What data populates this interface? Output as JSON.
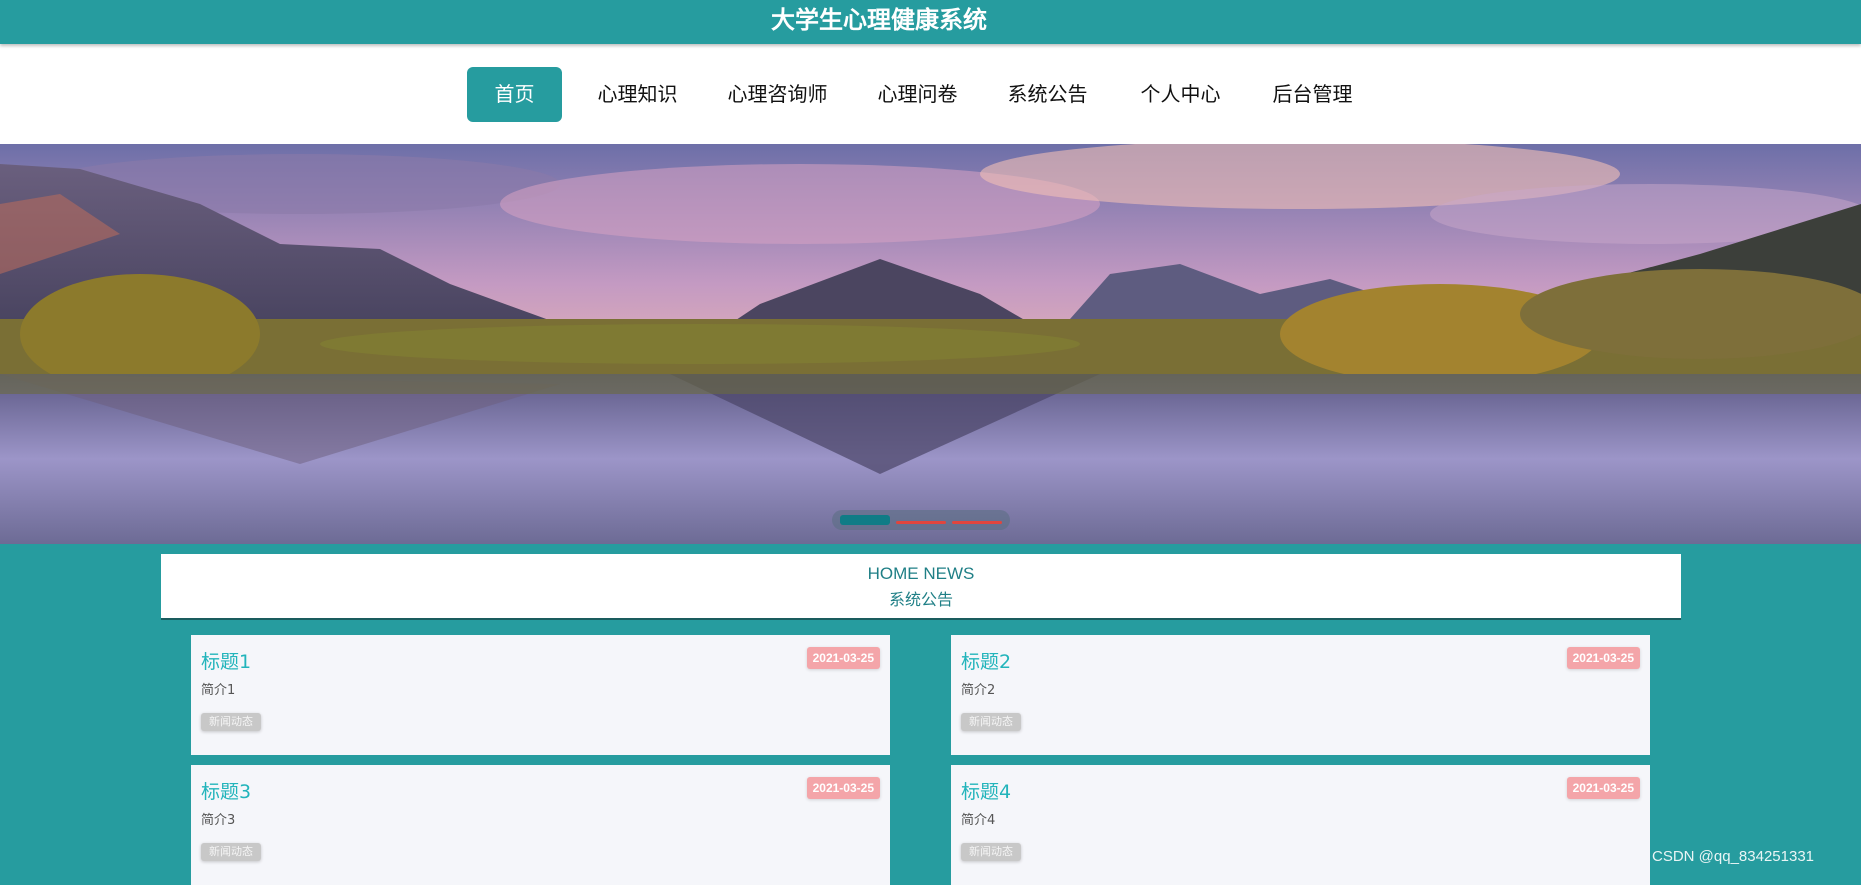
{
  "header": {
    "site_title": "大学生心理健康系统"
  },
  "nav": {
    "items": [
      {
        "label": "首页",
        "active": true
      },
      {
        "label": "心理知识",
        "active": false
      },
      {
        "label": "心理咨询师",
        "active": false
      },
      {
        "label": "心理问卷",
        "active": false
      },
      {
        "label": "系统公告",
        "active": false
      },
      {
        "label": "个人中心",
        "active": false
      },
      {
        "label": "后台管理",
        "active": false
      }
    ]
  },
  "carousel": {
    "active_index": 0,
    "slide_count": 3
  },
  "news_section": {
    "title_en": "HOME NEWS",
    "title_cn": "系统公告"
  },
  "news": [
    {
      "title": "标题1",
      "date": "2021-03-25",
      "summary": "简介1",
      "tag": "新闻动态"
    },
    {
      "title": "标题2",
      "date": "2021-03-25",
      "summary": "简介2",
      "tag": "新闻动态"
    },
    {
      "title": "标题3",
      "date": "2021-03-25",
      "summary": "简介3",
      "tag": "新闻动态"
    },
    {
      "title": "标题4",
      "date": "2021-03-25",
      "summary": "简介4",
      "tag": "新闻动态"
    }
  ],
  "watermark": "CSDN @qq_834251331",
  "colors": {
    "primary": "#269c9f",
    "title_text": "#22b4bb",
    "date_badge": "#f4a5a9",
    "tag_badge": "#c8c8c8",
    "card_bg": "#f5f6fa"
  }
}
